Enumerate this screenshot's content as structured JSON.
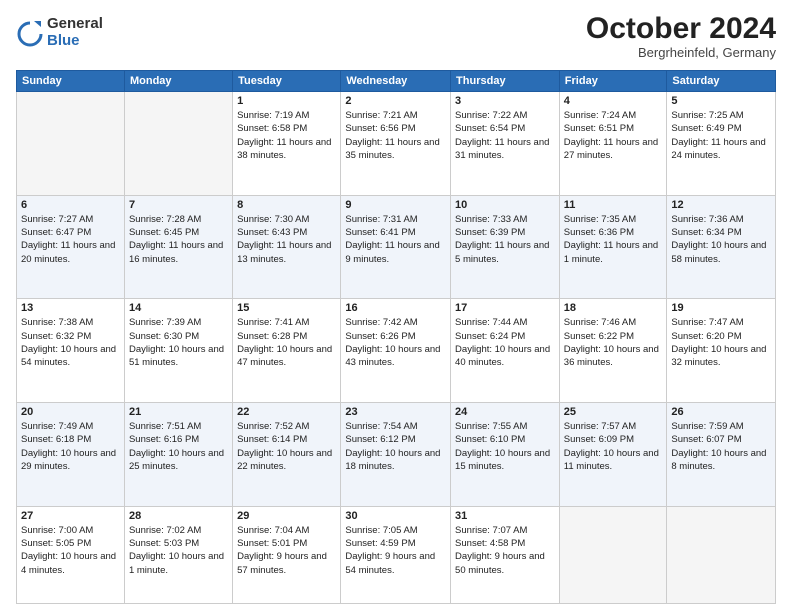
{
  "logo": {
    "general": "General",
    "blue": "Blue"
  },
  "title": "October 2024",
  "location": "Bergrheinfeld, Germany",
  "days_of_week": [
    "Sunday",
    "Monday",
    "Tuesday",
    "Wednesday",
    "Thursday",
    "Friday",
    "Saturday"
  ],
  "weeks": [
    [
      {
        "num": "",
        "info": ""
      },
      {
        "num": "",
        "info": ""
      },
      {
        "num": "1",
        "info": "Sunrise: 7:19 AM\nSunset: 6:58 PM\nDaylight: 11 hours and 38 minutes."
      },
      {
        "num": "2",
        "info": "Sunrise: 7:21 AM\nSunset: 6:56 PM\nDaylight: 11 hours and 35 minutes."
      },
      {
        "num": "3",
        "info": "Sunrise: 7:22 AM\nSunset: 6:54 PM\nDaylight: 11 hours and 31 minutes."
      },
      {
        "num": "4",
        "info": "Sunrise: 7:24 AM\nSunset: 6:51 PM\nDaylight: 11 hours and 27 minutes."
      },
      {
        "num": "5",
        "info": "Sunrise: 7:25 AM\nSunset: 6:49 PM\nDaylight: 11 hours and 24 minutes."
      }
    ],
    [
      {
        "num": "6",
        "info": "Sunrise: 7:27 AM\nSunset: 6:47 PM\nDaylight: 11 hours and 20 minutes."
      },
      {
        "num": "7",
        "info": "Sunrise: 7:28 AM\nSunset: 6:45 PM\nDaylight: 11 hours and 16 minutes."
      },
      {
        "num": "8",
        "info": "Sunrise: 7:30 AM\nSunset: 6:43 PM\nDaylight: 11 hours and 13 minutes."
      },
      {
        "num": "9",
        "info": "Sunrise: 7:31 AM\nSunset: 6:41 PM\nDaylight: 11 hours and 9 minutes."
      },
      {
        "num": "10",
        "info": "Sunrise: 7:33 AM\nSunset: 6:39 PM\nDaylight: 11 hours and 5 minutes."
      },
      {
        "num": "11",
        "info": "Sunrise: 7:35 AM\nSunset: 6:36 PM\nDaylight: 11 hours and 1 minute."
      },
      {
        "num": "12",
        "info": "Sunrise: 7:36 AM\nSunset: 6:34 PM\nDaylight: 10 hours and 58 minutes."
      }
    ],
    [
      {
        "num": "13",
        "info": "Sunrise: 7:38 AM\nSunset: 6:32 PM\nDaylight: 10 hours and 54 minutes."
      },
      {
        "num": "14",
        "info": "Sunrise: 7:39 AM\nSunset: 6:30 PM\nDaylight: 10 hours and 51 minutes."
      },
      {
        "num": "15",
        "info": "Sunrise: 7:41 AM\nSunset: 6:28 PM\nDaylight: 10 hours and 47 minutes."
      },
      {
        "num": "16",
        "info": "Sunrise: 7:42 AM\nSunset: 6:26 PM\nDaylight: 10 hours and 43 minutes."
      },
      {
        "num": "17",
        "info": "Sunrise: 7:44 AM\nSunset: 6:24 PM\nDaylight: 10 hours and 40 minutes."
      },
      {
        "num": "18",
        "info": "Sunrise: 7:46 AM\nSunset: 6:22 PM\nDaylight: 10 hours and 36 minutes."
      },
      {
        "num": "19",
        "info": "Sunrise: 7:47 AM\nSunset: 6:20 PM\nDaylight: 10 hours and 32 minutes."
      }
    ],
    [
      {
        "num": "20",
        "info": "Sunrise: 7:49 AM\nSunset: 6:18 PM\nDaylight: 10 hours and 29 minutes."
      },
      {
        "num": "21",
        "info": "Sunrise: 7:51 AM\nSunset: 6:16 PM\nDaylight: 10 hours and 25 minutes."
      },
      {
        "num": "22",
        "info": "Sunrise: 7:52 AM\nSunset: 6:14 PM\nDaylight: 10 hours and 22 minutes."
      },
      {
        "num": "23",
        "info": "Sunrise: 7:54 AM\nSunset: 6:12 PM\nDaylight: 10 hours and 18 minutes."
      },
      {
        "num": "24",
        "info": "Sunrise: 7:55 AM\nSunset: 6:10 PM\nDaylight: 10 hours and 15 minutes."
      },
      {
        "num": "25",
        "info": "Sunrise: 7:57 AM\nSunset: 6:09 PM\nDaylight: 10 hours and 11 minutes."
      },
      {
        "num": "26",
        "info": "Sunrise: 7:59 AM\nSunset: 6:07 PM\nDaylight: 10 hours and 8 minutes."
      }
    ],
    [
      {
        "num": "27",
        "info": "Sunrise: 7:00 AM\nSunset: 5:05 PM\nDaylight: 10 hours and 4 minutes."
      },
      {
        "num": "28",
        "info": "Sunrise: 7:02 AM\nSunset: 5:03 PM\nDaylight: 10 hours and 1 minute."
      },
      {
        "num": "29",
        "info": "Sunrise: 7:04 AM\nSunset: 5:01 PM\nDaylight: 9 hours and 57 minutes."
      },
      {
        "num": "30",
        "info": "Sunrise: 7:05 AM\nSunset: 4:59 PM\nDaylight: 9 hours and 54 minutes."
      },
      {
        "num": "31",
        "info": "Sunrise: 7:07 AM\nSunset: 4:58 PM\nDaylight: 9 hours and 50 minutes."
      },
      {
        "num": "",
        "info": ""
      },
      {
        "num": "",
        "info": ""
      }
    ]
  ]
}
